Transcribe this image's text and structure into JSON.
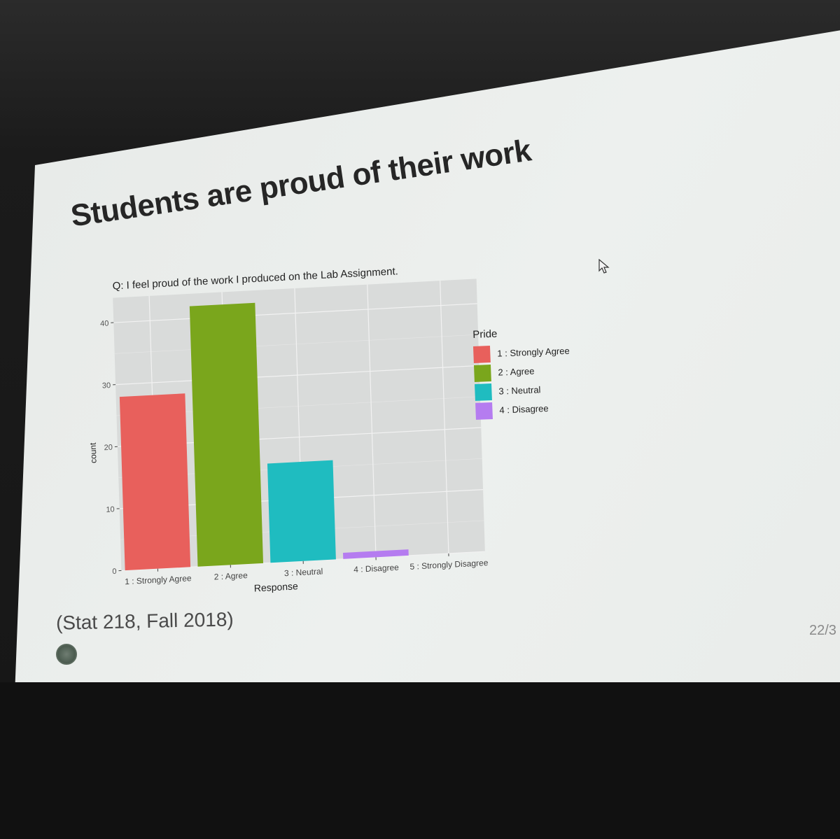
{
  "slide": {
    "title": "Students are proud of their work",
    "citation": "(Stat 218, Fall 2018)",
    "page_number": "22/3"
  },
  "chart_data": {
    "type": "bar",
    "title": "Q: I feel proud of the work I produced on the Lab Assignment.",
    "xlabel": "Response",
    "ylabel": "count",
    "categories": [
      "1 : Strongly Agree",
      "2 : Agree",
      "3 : Neutral",
      "4 : Disagree",
      "5 : Strongly Disagree"
    ],
    "values": [
      28,
      42,
      16,
      1,
      0
    ],
    "ylim": [
      0,
      44
    ],
    "yticks": [
      0,
      10,
      20,
      30,
      40
    ],
    "colors": [
      "#e8605c",
      "#7aa61c",
      "#1fbcc0",
      "#b57cf0"
    ],
    "grid": true,
    "legend": {
      "title": "Pride",
      "position": "right",
      "entries": [
        "1 : Strongly Agree",
        "2 : Agree",
        "3 : Neutral",
        "4 : Disagree"
      ]
    }
  }
}
